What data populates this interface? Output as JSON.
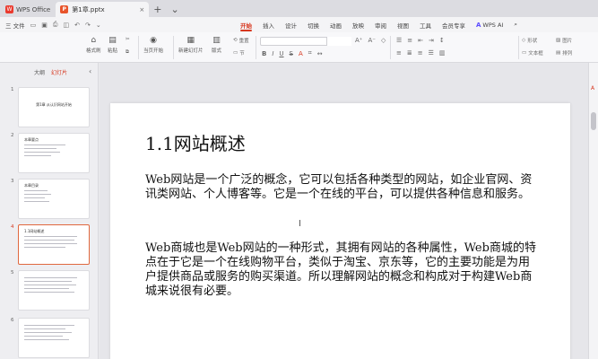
{
  "titlebar": {
    "app_name": "WPS Office",
    "doc_tab": "第1章.pptx",
    "close_glyph": "×",
    "new_tab_glyph": "+"
  },
  "menubar": {
    "file_label": "三 文件",
    "tabs": [
      "开始",
      "插入",
      "设计",
      "切换",
      "动画",
      "放映",
      "审阅",
      "视图",
      "工具",
      "会员专享"
    ],
    "active_tab": "开始",
    "wps_ai": "WPS AI"
  },
  "ribbon": {
    "format_painter": "格式刷",
    "paste": "粘贴",
    "play_from_current": "当页开始",
    "new_slide": "新建幻灯片",
    "layout": "版式",
    "section": "节",
    "reset": "重置",
    "shape": "形状",
    "picture": "图片",
    "textbox": "文本框",
    "arrange": "排列"
  },
  "leftpanel": {
    "tabs": [
      "大纲",
      "幻灯片"
    ],
    "active_tab": "幻灯片",
    "slides": [
      {
        "num": "1",
        "title": "第1章 从认识网站开始"
      },
      {
        "num": "2",
        "title": "本章要点"
      },
      {
        "num": "3",
        "title": "本章目录"
      },
      {
        "num": "4",
        "title": "1.1网站概述"
      },
      {
        "num": "5",
        "title": ""
      },
      {
        "num": "6",
        "title": ""
      }
    ],
    "active_slide": "4"
  },
  "slide": {
    "title": "1.1网站概述",
    "para1": "Web网站是一个广泛的概念，它可以包括各种类型的网站，如企业官网、资讯类网站、个人博客等。它是一个在线的平台，可以提供各种信息和服务。",
    "para2": "Web商城也是Web网站的一种形式，其拥有网站的各种属性，Web商城的特点在于它是一个在线购物平台，类似于淘宝、京东等，它的主要功能是为用户提供商品或服务的购买渠道。所以理解网站的概念和构成对于构建Web商城来说很有必要。"
  }
}
